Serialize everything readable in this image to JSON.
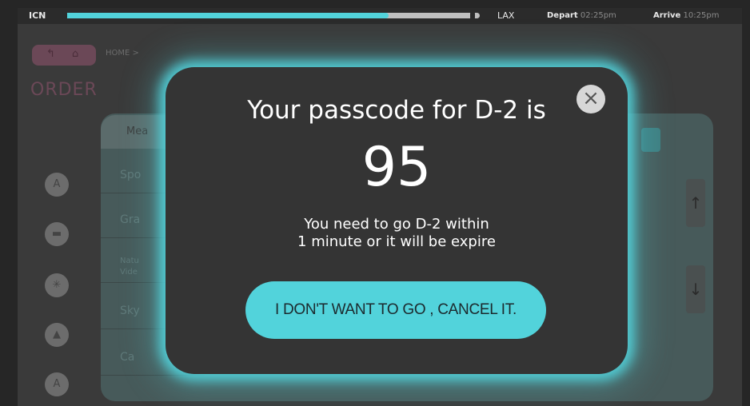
{
  "flight": {
    "origin": "ICN",
    "destination": "LAX",
    "depart_label": "Depart",
    "depart_time": "02:25pm",
    "arrive_label": "Arrive",
    "arrive_time": "10:25pm",
    "progress": 0.78,
    "progress_color": "#52d3db"
  },
  "background": {
    "breadcrumb": "HOME >",
    "page_title": "ORDER",
    "tab_label": "Mea",
    "list_items": [
      "Spo",
      "Gra",
      "Natu\nVide",
      "Sky",
      "Ca"
    ]
  },
  "modal": {
    "title": "Your passcode for D-2 is",
    "passcode": "95",
    "message_line1": "You need to go D-2 within",
    "message_line2": "1 minute or it will be expire",
    "cancel_button": "I DON'T WANT TO GO , CANCEL IT.",
    "close_glyph": "×",
    "accent_color": "#52d3db"
  }
}
